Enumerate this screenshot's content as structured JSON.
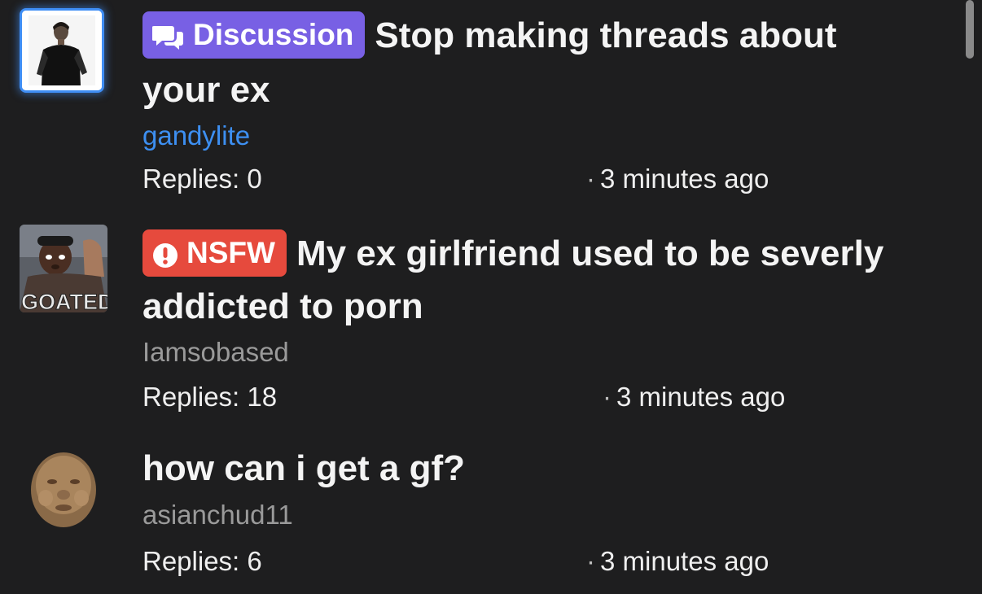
{
  "threads": [
    {
      "badge": {
        "label": "Discussion",
        "icon": "chat-bubbles-icon",
        "color": "#7860e4"
      },
      "title_line1": "Stop making threads about",
      "title_line2": "your ex",
      "author": "gandylite",
      "author_color": "#3d8ff1",
      "replies": "Replies: 0",
      "time": "3 minutes ago",
      "avatar": "avatar-man-black-shirt"
    },
    {
      "badge": {
        "label": "NSFW",
        "icon": "exclamation-circle-icon",
        "color": "#e64a3d"
      },
      "title_line1": "My ex girlfriend used to be severly",
      "title_line2": "addicted to porn",
      "author": "Iamsobased",
      "author_color": "#9a9a9a",
      "replies": "Replies: 18",
      "time": "3 minutes ago",
      "avatar": "avatar-goated-meme",
      "avatar_text": "GOATED"
    },
    {
      "title_line1": "how can i get a gf?",
      "author": "asianchud11",
      "author_color": "#9a9a9a",
      "replies": "Replies: 6",
      "time": "3 minutes ago",
      "avatar": "avatar-chubby-face"
    }
  ],
  "time_separator": "·"
}
